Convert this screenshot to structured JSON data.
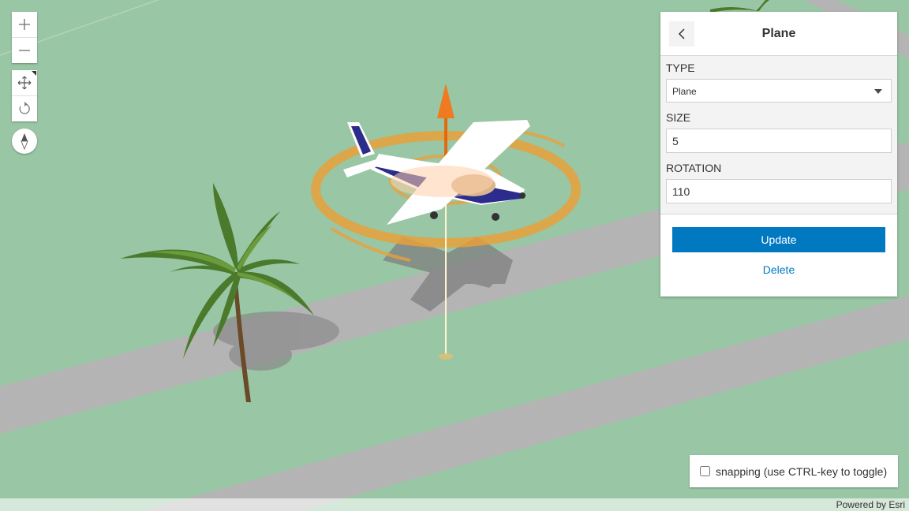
{
  "navigation": {
    "zoom_in_icon": "plus-icon",
    "zoom_out_icon": "minus-icon",
    "pan_icon": "move-arrows-icon",
    "rotate_icon": "rotate-icon",
    "compass_icon": "compass-icon"
  },
  "panel": {
    "title": "Plane",
    "back_icon": "chevron-left-icon",
    "type_label": "TYPE",
    "type_value": "Plane",
    "size_label": "SIZE",
    "size_value": "5",
    "rotation_label": "ROTATION",
    "rotation_value": "110",
    "update_label": "Update",
    "delete_label": "Delete"
  },
  "snapping": {
    "label": "snapping (use CTRL-key to toggle)",
    "checked": false
  },
  "attribution": "Powered by Esri",
  "colors": {
    "ground": "#99c6a4",
    "road": "#b4b4b4",
    "accent": "#0079c1",
    "manipulator": "#e8a03c"
  }
}
